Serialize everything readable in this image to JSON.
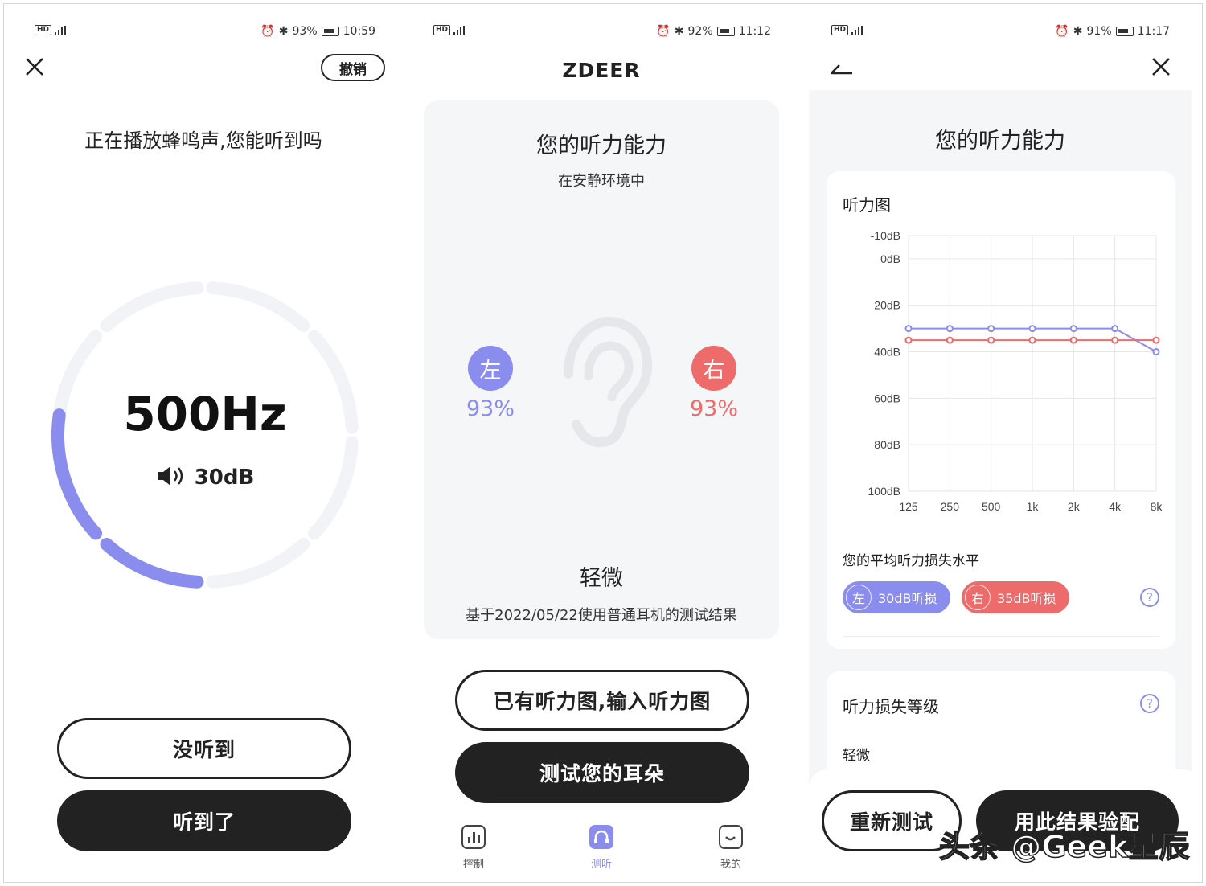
{
  "panel1": {
    "status": {
      "battery": "93%",
      "time": "10:59"
    },
    "undo_label": "撤销",
    "question": "正在播放蜂鸣声,您能听到吗",
    "frequency": "500Hz",
    "volume": "30dB",
    "not_heard_label": "没听到",
    "heard_label": "听到了",
    "progress_fraction": 0.28
  },
  "panel2": {
    "status": {
      "battery": "92%",
      "time": "11:12"
    },
    "brand": "ZDEER",
    "title": "您的听力能力",
    "subtitle": "在安静环境中",
    "left_label": "左",
    "left_pct": "93%",
    "right_label": "右",
    "right_pct": "93%",
    "level": "轻微",
    "basis": "基于2022/05/22使用普通耳机的测试结果",
    "input_chart_label": "已有听力图,输入听力图",
    "test_label": "测试您的耳朵",
    "nav": [
      {
        "label": "控制",
        "icon": "bar-chart-icon"
      },
      {
        "label": "测听",
        "icon": "headphones-icon"
      },
      {
        "label": "我的",
        "icon": "smile-icon"
      }
    ]
  },
  "panel3": {
    "status": {
      "battery": "91%",
      "time": "11:17"
    },
    "title": "您的听力能力",
    "chart_title": "听力图",
    "avg_label": "您的平均听力损失水平",
    "left_badge_side": "左",
    "left_badge_text": "30dB听损",
    "right_badge_side": "右",
    "right_badge_text": "35dB听损",
    "loss_grade_title": "听力损失等级",
    "loss_grade_value": "轻微",
    "retest_label": "重新测试",
    "use_result_label": "用此结果验配"
  },
  "watermark": "头条 @Geek星辰",
  "colors": {
    "left": "#8a8cee",
    "right": "#ee6b6b",
    "dark": "#222222",
    "card": "#f5f6f8"
  },
  "chart_data": {
    "type": "line",
    "title": "听力图",
    "categories": [
      "125",
      "250",
      "500",
      "1k",
      "2k",
      "4k",
      "8k"
    ],
    "y_ticks": [
      "-10dB",
      "0dB",
      "20dB",
      "40dB",
      "60dB",
      "80dB",
      "100dB"
    ],
    "y_tick_values": [
      -10,
      0,
      20,
      40,
      60,
      80,
      100
    ],
    "ylim": [
      -10,
      100
    ],
    "y_inverted": true,
    "grid": true,
    "series": [
      {
        "color": "#8a8cee",
        "values": [
          30,
          30,
          30,
          30,
          30,
          30,
          40
        ]
      },
      {
        "color": "#ee6b6b",
        "values": [
          35,
          35,
          35,
          35,
          35,
          35,
          35
        ]
      }
    ]
  }
}
